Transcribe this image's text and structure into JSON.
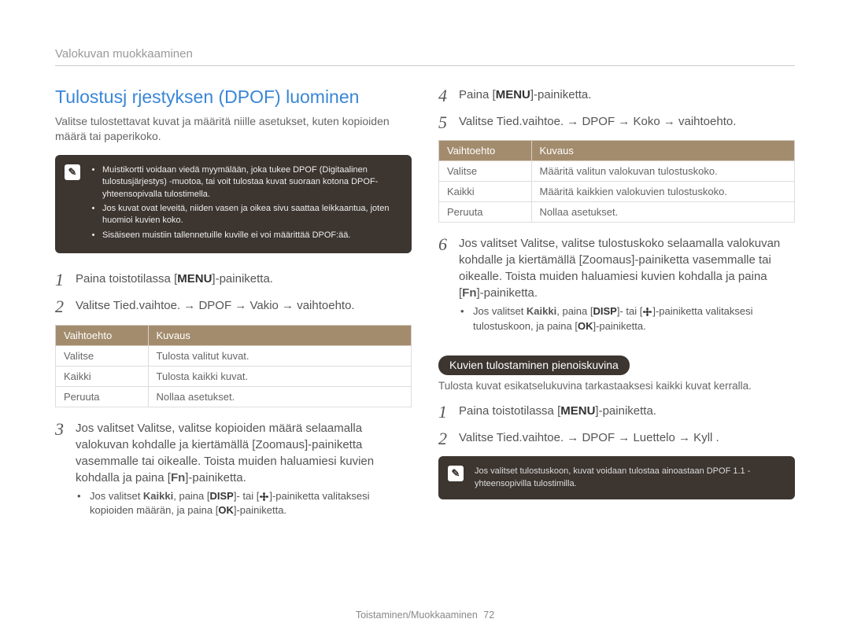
{
  "breadcrumb": "Valokuvan muokkaaminen",
  "title": "Tulostusj rjestyksen (DPOF) luominen",
  "intro": "Valitse tulostettavat kuvat ja määritä niille asetukset, kuten kopioiden määrä tai paperikoko.",
  "note1": {
    "items": [
      "Muistikortti voidaan viedä myymälään, joka tukee DPOF (Digitaalinen tulostusjärjestys) -muotoa, tai voit tulostaa kuvat suoraan kotona DPOF-yhteensopivalla tulostimella.",
      "Jos kuvat ovat leveitä, niiden vasen ja oikea sivu saattaa leikkaantua, joten huomioi kuvien koko.",
      "Sisäiseen muistiin tallennetuille kuville ei voi määrittää DPOF:ää."
    ]
  },
  "labels": {
    "MENU": "MENU",
    "DISP": "DISP",
    "Fn": "Fn",
    "OK": "OK"
  },
  "left": {
    "step1_a": "Paina toistotilassa [",
    "step1_b": "]-painiketta.",
    "step2": "Valitse Tied.vaihtoe. → DPOF → Vakio → vaihtoehto.",
    "table_h1": "Vaihtoehto",
    "table_h2": "Kuvaus",
    "rows": [
      {
        "opt": "Valitse",
        "desc": "Tulosta valitut kuvat."
      },
      {
        "opt": "Kaikki",
        "desc": "Tulosta kaikki kuvat."
      },
      {
        "opt": "Peruuta",
        "desc": "Nollaa asetukset."
      }
    ],
    "step3": "Jos valitset Valitse, valitse kopioiden määrä selaamalla valokuvan kohdalle ja kiertämällä [Zoomaus]-painiketta vasemmalle tai oikealle. Toista muiden haluamiesi kuvien kohdalla ja paina [",
    "step3_b": "]-painiketta.",
    "sub_a": "Jos valitset ",
    "sub_bold1": "Kaikki",
    "sub_b": ", paina [",
    "sub_c": "]- tai [",
    "sub_d": "]-painiketta valitaksesi kopioiden määrän, ja paina [",
    "sub_e": "]-painiketta."
  },
  "right": {
    "step4_a": "Paina [",
    "step4_b": "]-painiketta.",
    "step5": "Valitse Tied.vaihtoe. → DPOF → Koko → vaihtoehto.",
    "table_h1": "Vaihtoehto",
    "table_h2": "Kuvaus",
    "rows": [
      {
        "opt": "Valitse",
        "desc": "Määritä valitun valokuvan tulostuskoko."
      },
      {
        "opt": "Kaikki",
        "desc": "Määritä kaikkien valokuvien tulostuskoko."
      },
      {
        "opt": "Peruuta",
        "desc": "Nollaa asetukset."
      }
    ],
    "step6": "Jos valitset Valitse, valitse tulostuskoko selaamalla valokuvan kohdalle ja kiertämällä [Zoomaus]-painiketta vasemmalle tai oikealle. Toista muiden haluamiesi kuvien kohdalla ja paina [",
    "step6_b": "]-painiketta.",
    "sub_a": "Jos valitset ",
    "sub_bold1": "Kaikki",
    "sub_b": ", paina [",
    "sub_c": "]- tai [",
    "sub_d": "]-painiketta valitaksesi tulostuskoon, ja paina [",
    "sub_e": "]-painiketta.",
    "pill": "Kuvien tulostaminen pienoiskuvina",
    "pill_desc": "Tulosta kuvat esikatselukuvina tarkastaaksesi kaikki kuvat kerralla.",
    "pstep1_a": "Paina toistotilassa [",
    "pstep1_b": "]-painiketta.",
    "pstep2": "Valitse Tied.vaihtoe. → DPOF → Luettelo → Kyll .",
    "note2": "Jos valitset tulostuskoon, kuvat voidaan tulostaa ainoastaan DPOF 1.1 -yhteensopivilla tulostimilla."
  },
  "footer": {
    "section": "Toistaminen/Muokkaaminen",
    "page": "72"
  }
}
